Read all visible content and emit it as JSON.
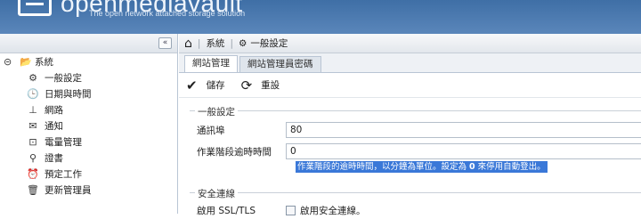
{
  "header": {
    "brand": "openmediavault",
    "tagline": "The open network attached storage solution"
  },
  "left": {
    "collapse_label": "«",
    "root": {
      "label": "系統",
      "expander_icon": "collapse-icon",
      "icon": "folder-open-icon"
    },
    "items": [
      {
        "label": "一般設定",
        "icon": "gear-icon"
      },
      {
        "label": "日期與時間",
        "icon": "clock-icon"
      },
      {
        "label": "網路",
        "icon": "network-icon"
      },
      {
        "label": "通知",
        "icon": "mail-icon"
      },
      {
        "label": "電量管理",
        "icon": "power-icon"
      },
      {
        "label": "證書",
        "icon": "certificate-icon"
      },
      {
        "label": "預定工作",
        "icon": "alarm-icon"
      },
      {
        "label": "更新管理員",
        "icon": "trash-icon"
      }
    ]
  },
  "breadcrumb": {
    "home_icon": "home-icon",
    "items": [
      "系統",
      "一般設定"
    ]
  },
  "tabs": [
    "網站管理",
    "網站管理員密碼"
  ],
  "toolbar": {
    "save_label": "儲存",
    "reset_label": "重設"
  },
  "general": {
    "legend": "一般設定",
    "port_label": "通訊埠",
    "port_value": "80",
    "timeout_label": "作業階段逾時時間",
    "timeout_value": "0",
    "timeout_hint_pre": "作業階段的逾時時間，以分鐘為單位。設定為 ",
    "timeout_hint_bold": "0",
    "timeout_hint_post": " 來停用自動登出。"
  },
  "secure": {
    "legend": "安全連線",
    "ssl_label": "啟用 SSL/TLS",
    "ssl_checkbox_label": "啟用安全連線。"
  },
  "colors": {
    "header": "#3f6fa6",
    "hint_highlight": "#3a78d8"
  }
}
